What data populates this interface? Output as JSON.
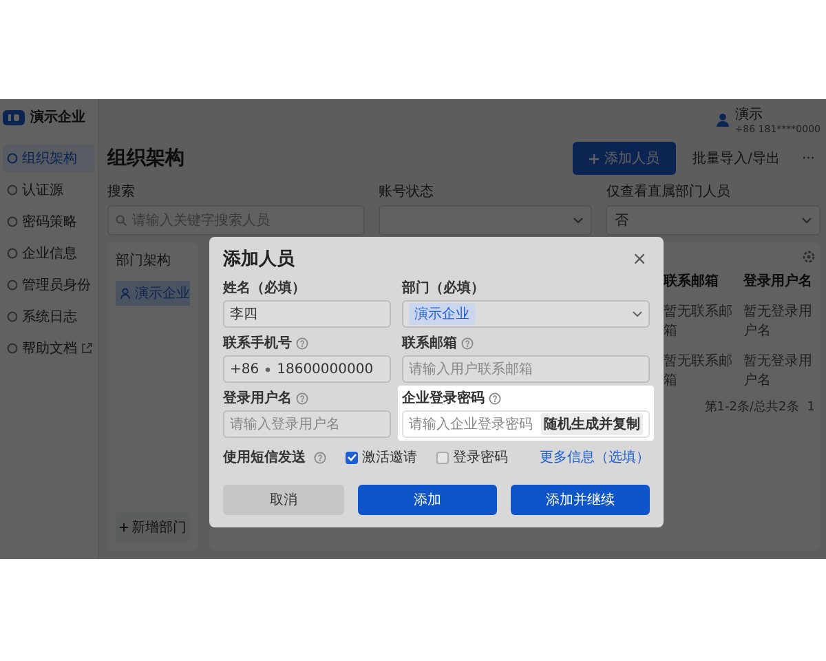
{
  "sidebar": {
    "brand": "演示企业",
    "items": [
      {
        "label": "组织架构",
        "selected": true,
        "kind": "page"
      },
      {
        "label": "认证源",
        "selected": false,
        "kind": "page"
      },
      {
        "label": "密码策略",
        "selected": false,
        "kind": "page"
      },
      {
        "label": "企业信息",
        "selected": false,
        "kind": "page"
      },
      {
        "label": "管理员身份",
        "selected": false,
        "kind": "page"
      },
      {
        "label": "系统日志",
        "selected": false,
        "kind": "page"
      },
      {
        "label": "帮助文档",
        "selected": false,
        "kind": "external"
      }
    ]
  },
  "user": {
    "name": "演示",
    "phone": "+86 181****0000"
  },
  "page": {
    "title": "组织架构",
    "add_button": "添加人员",
    "import_button": "批量导入/导出",
    "more_button": "···"
  },
  "filters": [
    {
      "label": "搜索",
      "placeholder": "请输入关键字搜索人员",
      "kind": "search"
    },
    {
      "label": "账号状态",
      "kind": "select"
    },
    {
      "label": "仅查看直属部门人员",
      "value": "否",
      "kind": "select"
    }
  ],
  "departments": {
    "title": "部门架构",
    "items": [
      {
        "label": "演示企业",
        "selected": true
      }
    ],
    "add_button": "新增部门"
  },
  "table": {
    "columns": [
      "联系邮箱",
      "登录用户名"
    ],
    "rows": [
      [
        "暂无联系邮箱",
        "暂无登录用户名"
      ],
      [
        "暂无联系邮箱",
        "暂无登录用户名"
      ]
    ],
    "footer": "第1-2条/总共2条",
    "page": "1"
  },
  "modal": {
    "title": "添加人员",
    "close": "×",
    "fields": [
      {
        "label": "姓名（必填）",
        "kind": "text",
        "value": "李四",
        "help": false,
        "highlighted": false
      },
      {
        "label": "部门（必填）",
        "kind": "select",
        "value": "演示企业",
        "help": false,
        "highlighted": false
      },
      {
        "label": "联系手机号",
        "kind": "phone",
        "prefix": "+86",
        "value": "18600000000",
        "help": true,
        "highlighted": false
      },
      {
        "label": "联系邮箱",
        "kind": "text",
        "placeholder": "请输入用户联系邮箱",
        "help": true,
        "highlighted": false
      },
      {
        "label": "登录用户名",
        "kind": "text",
        "placeholder": "请输入登录用户名",
        "help": true,
        "highlighted": false
      },
      {
        "label": "企业登录密码",
        "kind": "password",
        "placeholder": "请输入企业登录密码",
        "button": "随机生成并复制",
        "help": true,
        "highlighted": true
      }
    ],
    "sms": {
      "label": "使用短信发送",
      "help": true,
      "options": [
        {
          "label": "激活邀请",
          "checked": true
        },
        {
          "label": "登录密码",
          "checked": false
        }
      ]
    },
    "more_link": "更多信息（选填）",
    "buttons": [
      {
        "label": "取消",
        "kind": "secondary"
      },
      {
        "label": "添加",
        "kind": "primary"
      },
      {
        "label": "添加并继续",
        "kind": "primary"
      }
    ]
  }
}
